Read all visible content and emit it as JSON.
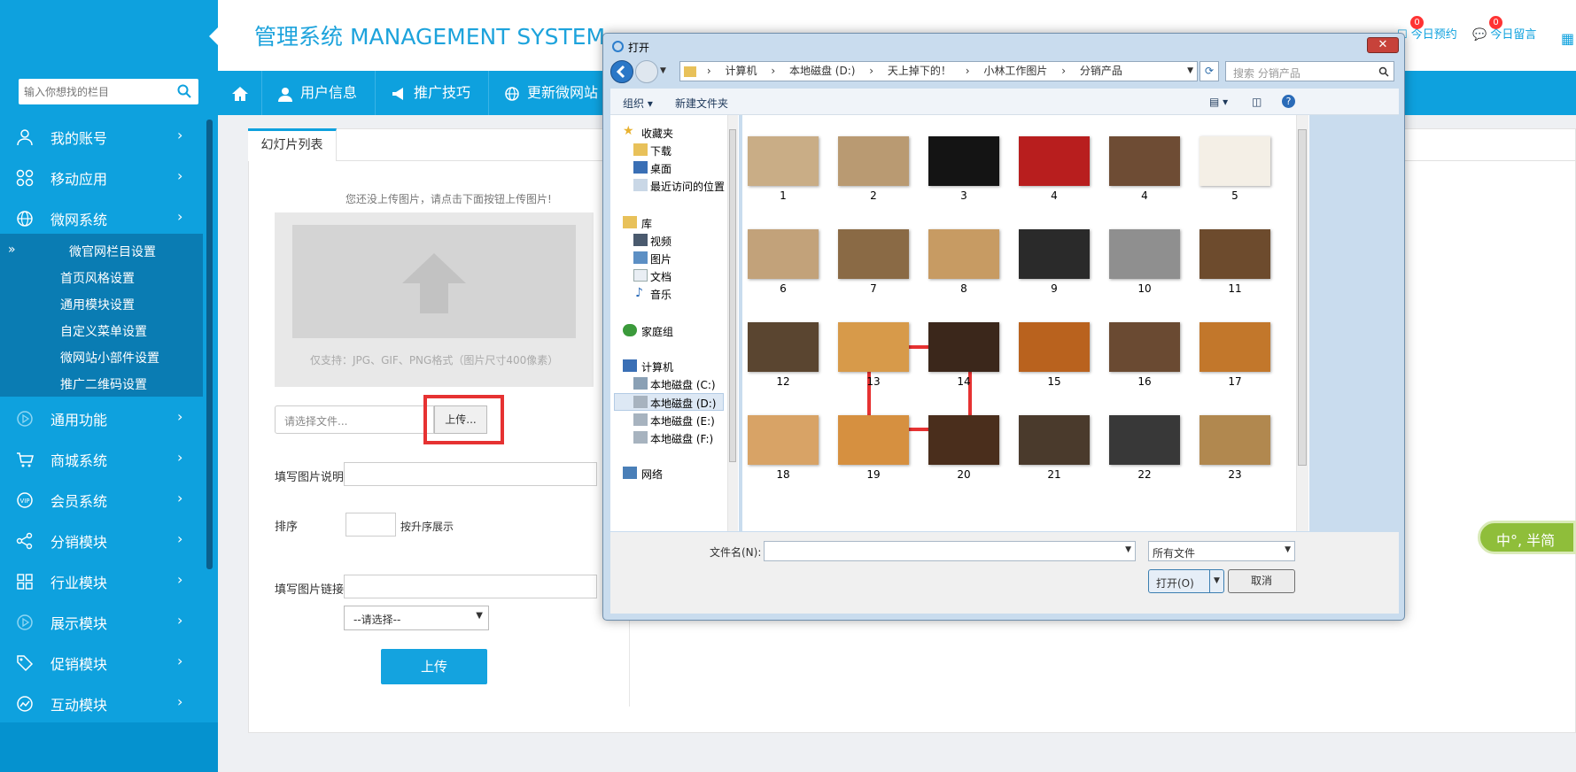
{
  "app": {
    "title": "管理系统 MANAGEMENT SYSTEM"
  },
  "sidebar": {
    "search_placeholder": "输入你想找的栏目",
    "items": [
      {
        "label": "我的账号",
        "icon": "user-icon"
      },
      {
        "label": "移动应用",
        "icon": "apps-icon"
      },
      {
        "label": "微网系统",
        "icon": "globe-icon"
      },
      {
        "label": "通用功能",
        "icon": "play-icon"
      },
      {
        "label": "商城系统",
        "icon": "cart-icon"
      },
      {
        "label": "会员系统",
        "icon": "vip-icon"
      },
      {
        "label": "分销模块",
        "icon": "share-icon"
      },
      {
        "label": "行业模块",
        "icon": "grid-icon"
      },
      {
        "label": "展示模块",
        "icon": "play-icon"
      },
      {
        "label": "促销模块",
        "icon": "tag-icon"
      },
      {
        "label": "互动模块",
        "icon": "chart-icon"
      }
    ],
    "subitems": [
      "微官网栏目设置",
      "首页风格设置",
      "通用模块设置",
      "自定义菜单设置",
      "微网站小部件设置",
      "推广二维码设置"
    ],
    "sub_arrow": "»",
    "chevron": "›"
  },
  "nav": {
    "items": [
      {
        "label": "用户信息",
        "icon": "user-icon"
      },
      {
        "label": "推广技巧",
        "icon": "megaphone-icon"
      },
      {
        "label": "更新微网站",
        "icon": "globe-icon"
      }
    ]
  },
  "header_right": {
    "booking_label": "今日预约",
    "booking_count": "0",
    "message_label": "今日留言",
    "message_count": "0"
  },
  "content": {
    "tab": "幻灯片列表",
    "hint": "您还没上传图片，请点击下面按钮上传图片!",
    "format_note": "仅支持：JPG、GIF、PNG格式（图片尺寸400像素）",
    "file_placeholder": "请选择文件...",
    "file_button": "上传...",
    "desc_label": "填写图片说明",
    "order_label": "排序",
    "order_hint": "按升序展示",
    "link_label": "填写图片链接",
    "select_value": "--请选择--",
    "submit": "上传"
  },
  "ime_widget": {
    "label": "中°, 半简"
  },
  "dialog": {
    "title": "打开",
    "close": "✕",
    "breadcrumb": [
      "计算机",
      "本地磁盘 (D:)",
      "天上掉下的！",
      "小林工作图片",
      "分销产品"
    ],
    "search_placeholder": "搜索 分销产品",
    "organize": "组织 ▾",
    "new_folder": "新建文件夹",
    "nav_pane": {
      "favorites": "收藏夹",
      "downloads": "下载",
      "desktop": "桌面",
      "recent": "最近访问的位置",
      "libraries": "库",
      "videos": "视频",
      "pictures": "图片",
      "documents": "文档",
      "music": "音乐",
      "homegroup": "家庭组",
      "computer": "计算机",
      "drive_c": "本地磁盘 (C:)",
      "drive_d": "本地磁盘 (D:)",
      "drive_e": "本地磁盘 (E:)",
      "drive_f": "本地磁盘 (F:)",
      "network": "网络"
    },
    "files": [
      {
        "name": "1",
        "color": "#c9ad86"
      },
      {
        "name": "2",
        "color": "#b99a72"
      },
      {
        "name": "3",
        "color": "#141414"
      },
      {
        "name": "4",
        "color": "#b81e1e"
      },
      {
        "name": "4",
        "color": "#6e4c34"
      },
      {
        "name": "5",
        "color": "#f4efe6"
      },
      {
        "name": "6",
        "color": "#c2a27a"
      },
      {
        "name": "7",
        "color": "#8a6a45"
      },
      {
        "name": "8",
        "color": "#c79b63"
      },
      {
        "name": "9",
        "color": "#2a2a2a"
      },
      {
        "name": "10",
        "color": "#8f8f8f"
      },
      {
        "name": "11",
        "color": "#6d4b2d"
      },
      {
        "name": "12",
        "color": "#5a4530"
      },
      {
        "name": "13",
        "color": "#d79a4a"
      },
      {
        "name": "14",
        "color": "#3b271b"
      },
      {
        "name": "15",
        "color": "#b9621e"
      },
      {
        "name": "16",
        "color": "#6a4a32"
      },
      {
        "name": "17",
        "color": "#c2772b"
      },
      {
        "name": "18",
        "color": "#d8a366"
      },
      {
        "name": "19",
        "color": "#d69040"
      },
      {
        "name": "20",
        "color": "#4a2e1c"
      },
      {
        "name": "21",
        "color": "#4a3a2c"
      },
      {
        "name": "22",
        "color": "#383838"
      },
      {
        "name": "23",
        "color": "#b1884f"
      }
    ],
    "filename_label": "文件名(N):",
    "filetype": "所有文件",
    "open_button": "打开(O)",
    "cancel_button": "取消"
  },
  "colors": {
    "accent": "#0ea1de",
    "highlight": "#e63232"
  }
}
